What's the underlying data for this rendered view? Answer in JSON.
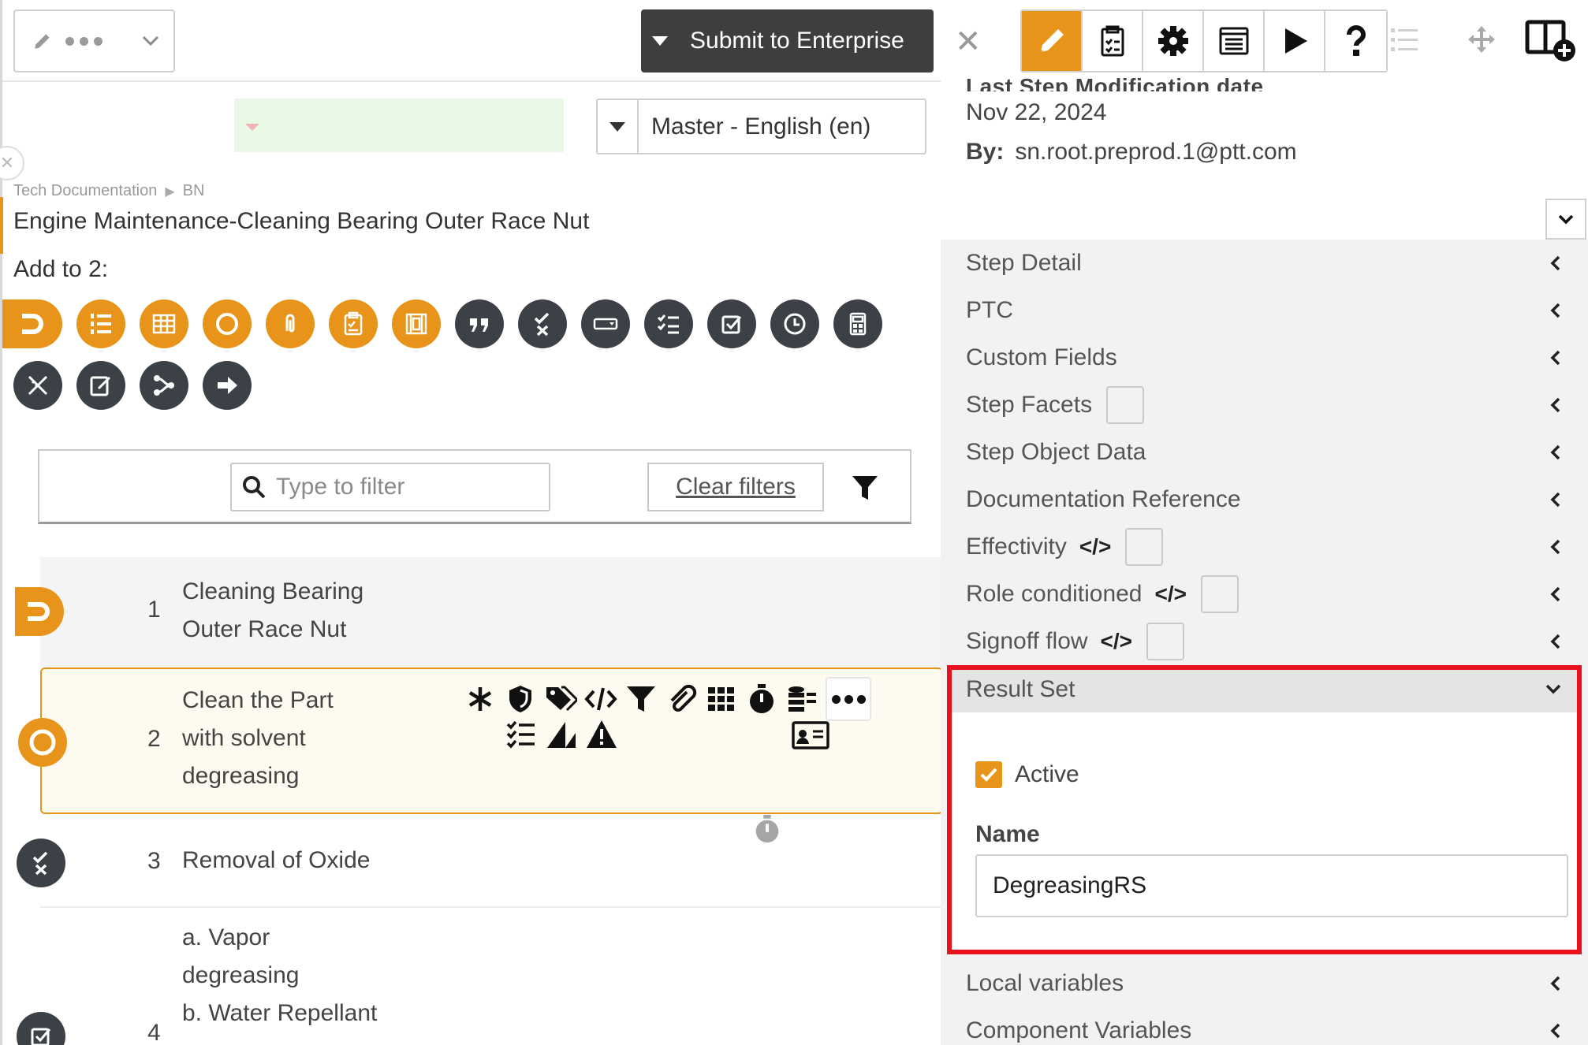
{
  "header": {
    "submit_label": "Submit to Enterprise",
    "language": "Master - English (en)"
  },
  "breadcrumb": [
    "Tech Documentation",
    "BN"
  ],
  "page_title": "Engine Maintenance-Cleaning Bearing Outer Race Nut",
  "add_to_label": "Add to 2:",
  "filter": {
    "placeholder": "Type to filter",
    "clear_label": "Clear filters"
  },
  "steps": [
    {
      "num": "1",
      "lines": [
        "Cleaning Bearing",
        "Outer Race Nut"
      ]
    },
    {
      "num": "2",
      "lines": [
        "Clean the Part",
        "with solvent",
        "degreasing"
      ]
    },
    {
      "num": "3",
      "lines": [
        "Removal of Oxide"
      ]
    },
    {
      "num": "4",
      "lines": [
        "a. Vapor",
        "degreasing",
        "b. Water Repellant"
      ]
    }
  ],
  "details": {
    "cut_label": "Last Step Modification date",
    "date": "Nov 22, 2024",
    "by_label": "By:",
    "by_value": "sn.root.preprod.1@ptt.com"
  },
  "sections": [
    "Step Detail",
    "PTC",
    "Custom Fields",
    "Step Facets",
    "Step Object Data",
    "Documentation Reference",
    "Effectivity",
    "Role conditioned",
    "Signoff flow"
  ],
  "code_icon": "</>",
  "result_set": {
    "title": "Result Set",
    "active_label": "Active",
    "active_checked": true,
    "name_label": "Name",
    "name_value": "DegreasingRS"
  },
  "after_sections": [
    "Local variables",
    "Component Variables"
  ],
  "colors": {
    "accent": "#e8941a",
    "dark": "#3c4147",
    "highlight": "#e8121c"
  }
}
